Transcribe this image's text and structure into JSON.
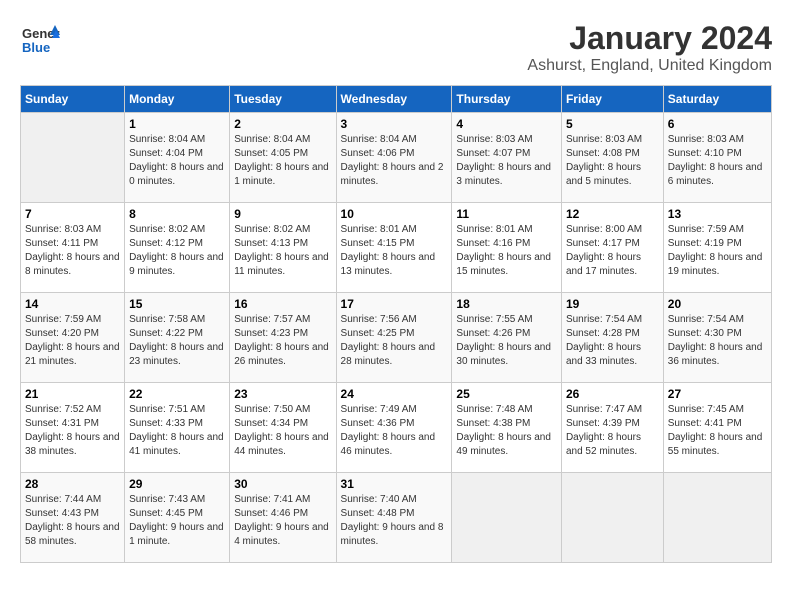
{
  "logo": {
    "general": "General",
    "blue": "Blue"
  },
  "title": "January 2024",
  "location": "Ashurst, England, United Kingdom",
  "days_of_week": [
    "Sunday",
    "Monday",
    "Tuesday",
    "Wednesday",
    "Thursday",
    "Friday",
    "Saturday"
  ],
  "weeks": [
    [
      {
        "day": "",
        "sunrise": "",
        "sunset": "",
        "daylight": ""
      },
      {
        "day": "1",
        "sunrise": "Sunrise: 8:04 AM",
        "sunset": "Sunset: 4:04 PM",
        "daylight": "Daylight: 8 hours and 0 minutes."
      },
      {
        "day": "2",
        "sunrise": "Sunrise: 8:04 AM",
        "sunset": "Sunset: 4:05 PM",
        "daylight": "Daylight: 8 hours and 1 minute."
      },
      {
        "day": "3",
        "sunrise": "Sunrise: 8:04 AM",
        "sunset": "Sunset: 4:06 PM",
        "daylight": "Daylight: 8 hours and 2 minutes."
      },
      {
        "day": "4",
        "sunrise": "Sunrise: 8:03 AM",
        "sunset": "Sunset: 4:07 PM",
        "daylight": "Daylight: 8 hours and 3 minutes."
      },
      {
        "day": "5",
        "sunrise": "Sunrise: 8:03 AM",
        "sunset": "Sunset: 4:08 PM",
        "daylight": "Daylight: 8 hours and 5 minutes."
      },
      {
        "day": "6",
        "sunrise": "Sunrise: 8:03 AM",
        "sunset": "Sunset: 4:10 PM",
        "daylight": "Daylight: 8 hours and 6 minutes."
      }
    ],
    [
      {
        "day": "7",
        "sunrise": "Sunrise: 8:03 AM",
        "sunset": "Sunset: 4:11 PM",
        "daylight": "Daylight: 8 hours and 8 minutes."
      },
      {
        "day": "8",
        "sunrise": "Sunrise: 8:02 AM",
        "sunset": "Sunset: 4:12 PM",
        "daylight": "Daylight: 8 hours and 9 minutes."
      },
      {
        "day": "9",
        "sunrise": "Sunrise: 8:02 AM",
        "sunset": "Sunset: 4:13 PM",
        "daylight": "Daylight: 8 hours and 11 minutes."
      },
      {
        "day": "10",
        "sunrise": "Sunrise: 8:01 AM",
        "sunset": "Sunset: 4:15 PM",
        "daylight": "Daylight: 8 hours and 13 minutes."
      },
      {
        "day": "11",
        "sunrise": "Sunrise: 8:01 AM",
        "sunset": "Sunset: 4:16 PM",
        "daylight": "Daylight: 8 hours and 15 minutes."
      },
      {
        "day": "12",
        "sunrise": "Sunrise: 8:00 AM",
        "sunset": "Sunset: 4:17 PM",
        "daylight": "Daylight: 8 hours and 17 minutes."
      },
      {
        "day": "13",
        "sunrise": "Sunrise: 7:59 AM",
        "sunset": "Sunset: 4:19 PM",
        "daylight": "Daylight: 8 hours and 19 minutes."
      }
    ],
    [
      {
        "day": "14",
        "sunrise": "Sunrise: 7:59 AM",
        "sunset": "Sunset: 4:20 PM",
        "daylight": "Daylight: 8 hours and 21 minutes."
      },
      {
        "day": "15",
        "sunrise": "Sunrise: 7:58 AM",
        "sunset": "Sunset: 4:22 PM",
        "daylight": "Daylight: 8 hours and 23 minutes."
      },
      {
        "day": "16",
        "sunrise": "Sunrise: 7:57 AM",
        "sunset": "Sunset: 4:23 PM",
        "daylight": "Daylight: 8 hours and 26 minutes."
      },
      {
        "day": "17",
        "sunrise": "Sunrise: 7:56 AM",
        "sunset": "Sunset: 4:25 PM",
        "daylight": "Daylight: 8 hours and 28 minutes."
      },
      {
        "day": "18",
        "sunrise": "Sunrise: 7:55 AM",
        "sunset": "Sunset: 4:26 PM",
        "daylight": "Daylight: 8 hours and 30 minutes."
      },
      {
        "day": "19",
        "sunrise": "Sunrise: 7:54 AM",
        "sunset": "Sunset: 4:28 PM",
        "daylight": "Daylight: 8 hours and 33 minutes."
      },
      {
        "day": "20",
        "sunrise": "Sunrise: 7:54 AM",
        "sunset": "Sunset: 4:30 PM",
        "daylight": "Daylight: 8 hours and 36 minutes."
      }
    ],
    [
      {
        "day": "21",
        "sunrise": "Sunrise: 7:52 AM",
        "sunset": "Sunset: 4:31 PM",
        "daylight": "Daylight: 8 hours and 38 minutes."
      },
      {
        "day": "22",
        "sunrise": "Sunrise: 7:51 AM",
        "sunset": "Sunset: 4:33 PM",
        "daylight": "Daylight: 8 hours and 41 minutes."
      },
      {
        "day": "23",
        "sunrise": "Sunrise: 7:50 AM",
        "sunset": "Sunset: 4:34 PM",
        "daylight": "Daylight: 8 hours and 44 minutes."
      },
      {
        "day": "24",
        "sunrise": "Sunrise: 7:49 AM",
        "sunset": "Sunset: 4:36 PM",
        "daylight": "Daylight: 8 hours and 46 minutes."
      },
      {
        "day": "25",
        "sunrise": "Sunrise: 7:48 AM",
        "sunset": "Sunset: 4:38 PM",
        "daylight": "Daylight: 8 hours and 49 minutes."
      },
      {
        "day": "26",
        "sunrise": "Sunrise: 7:47 AM",
        "sunset": "Sunset: 4:39 PM",
        "daylight": "Daylight: 8 hours and 52 minutes."
      },
      {
        "day": "27",
        "sunrise": "Sunrise: 7:45 AM",
        "sunset": "Sunset: 4:41 PM",
        "daylight": "Daylight: 8 hours and 55 minutes."
      }
    ],
    [
      {
        "day": "28",
        "sunrise": "Sunrise: 7:44 AM",
        "sunset": "Sunset: 4:43 PM",
        "daylight": "Daylight: 8 hours and 58 minutes."
      },
      {
        "day": "29",
        "sunrise": "Sunrise: 7:43 AM",
        "sunset": "Sunset: 4:45 PM",
        "daylight": "Daylight: 9 hours and 1 minute."
      },
      {
        "day": "30",
        "sunrise": "Sunrise: 7:41 AM",
        "sunset": "Sunset: 4:46 PM",
        "daylight": "Daylight: 9 hours and 4 minutes."
      },
      {
        "day": "31",
        "sunrise": "Sunrise: 7:40 AM",
        "sunset": "Sunset: 4:48 PM",
        "daylight": "Daylight: 9 hours and 8 minutes."
      },
      {
        "day": "",
        "sunrise": "",
        "sunset": "",
        "daylight": ""
      },
      {
        "day": "",
        "sunrise": "",
        "sunset": "",
        "daylight": ""
      },
      {
        "day": "",
        "sunrise": "",
        "sunset": "",
        "daylight": ""
      }
    ]
  ]
}
